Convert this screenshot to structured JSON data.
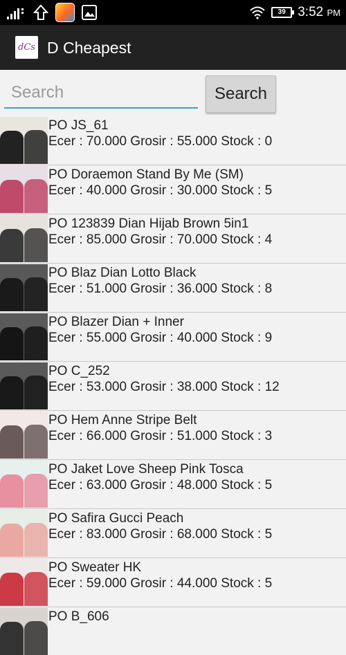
{
  "status_bar": {
    "time": "3:52",
    "ampm": "PM",
    "battery": "39",
    "icons": [
      "signal-icon",
      "upload-icon",
      "game-app-icon",
      "image-icon",
      "wifi-icon",
      "battery-icon"
    ]
  },
  "action_bar": {
    "logo_text": "dCs",
    "title": "D Cheapest"
  },
  "search": {
    "placeholder": "Search",
    "button_label": "Search"
  },
  "products": [
    {
      "name": "PO JS_61",
      "detail": "Ecer : 70.000 Grosir : 55.000 Stock : 0",
      "thumb_color": "#e9e6df",
      "accent": "#222222"
    },
    {
      "name": "PO Doraemon Stand By Me (SM)",
      "detail": "Ecer : 40.000 Grosir : 30.000 Stock : 5",
      "thumb_color": "#e8dfe6",
      "accent": "#c04a6a"
    },
    {
      "name": "PO 123839 Dian Hijab Brown 5in1",
      "detail": "Ecer : 85.000 Grosir : 70.000 Stock : 4",
      "thumb_color": "#e6e2dc",
      "accent": "#3a3a3a"
    },
    {
      "name": "PO Blaz Dian Lotto Black",
      "detail": "Ecer : 51.000 Grosir : 36.000 Stock : 8",
      "thumb_color": "#585858",
      "accent": "#1a1a1a"
    },
    {
      "name": "PO Blazer Dian + Inner",
      "detail": "Ecer : 55.000 Grosir : 40.000 Stock : 9",
      "thumb_color": "#5a5a5a",
      "accent": "#151515"
    },
    {
      "name": "PO C_252",
      "detail": "Ecer : 53.000 Grosir : 38.000 Stock : 12",
      "thumb_color": "#595959",
      "accent": "#181818"
    },
    {
      "name": "PO Hem Anne Stripe Belt",
      "detail": "Ecer : 66.000 Grosir : 51.000 Stock : 3",
      "thumb_color": "#f2e8e8",
      "accent": "#6a5a5a"
    },
    {
      "name": "PO Jaket Love Sheep Pink Tosca",
      "detail": "Ecer : 63.000 Grosir : 48.000 Stock : 5",
      "thumb_color": "#e6f1ee",
      "accent": "#e88fa0"
    },
    {
      "name": "PO Safira Gucci Peach",
      "detail": "Ecer : 83.000 Grosir : 68.000 Stock : 5",
      "thumb_color": "#e7eee6",
      "accent": "#e9a9a2"
    },
    {
      "name": "PO Sweater HK",
      "detail": "Ecer : 59.000 Grosir : 44.000 Stock : 5",
      "thumb_color": "#efe8e8",
      "accent": "#cc3a45"
    },
    {
      "name": "PO B_606",
      "detail": "",
      "thumb_color": "#d9d4cf",
      "accent": "#333333"
    }
  ]
}
